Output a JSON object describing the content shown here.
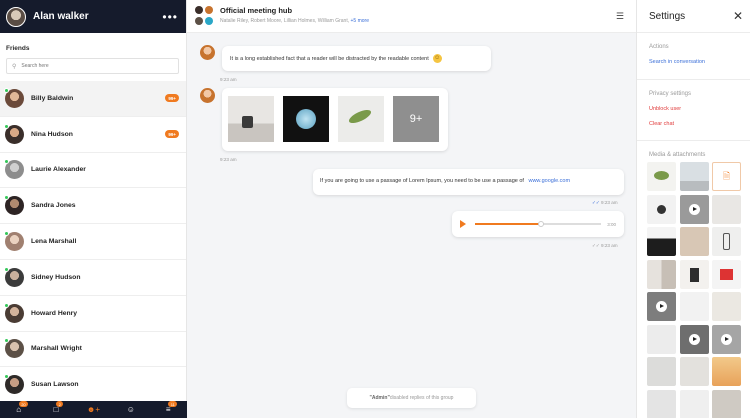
{
  "user": {
    "name": "Alan walker",
    "more_icon": "ellipsis-icon"
  },
  "friends": {
    "label": "Friends",
    "search_placeholder": "Search here",
    "items": [
      {
        "name": "Billy Baldwin",
        "badge": "99+",
        "color": "#6b4a3a"
      },
      {
        "name": "Nina Hudson",
        "badge": "99+",
        "color": "#3a2e2a"
      },
      {
        "name": "Laurie Alexander",
        "badge": "",
        "color": "#8d8d8d"
      },
      {
        "name": "Sandra Jones",
        "badge": "",
        "color": "#2d2424"
      },
      {
        "name": "Lena Marshall",
        "badge": "",
        "color": "#a08070"
      },
      {
        "name": "Sidney Hudson",
        "badge": "",
        "color": "#3b3b3b"
      },
      {
        "name": "Howard Henry",
        "badge": "",
        "color": "#4a3c34"
      },
      {
        "name": "Marshall Wright",
        "badge": "",
        "color": "#5c5046"
      },
      {
        "name": "Susan Lawson",
        "badge": "",
        "color": "#2e2a28"
      }
    ]
  },
  "bottom_nav": [
    {
      "icon": "home-icon",
      "badge": "20"
    },
    {
      "icon": "chat-icon",
      "badge": "2"
    },
    {
      "icon": "add-user-icon",
      "badge": ""
    },
    {
      "icon": "users-icon",
      "badge": ""
    },
    {
      "icon": "layers-icon",
      "badge": "11"
    }
  ],
  "chat": {
    "title": "Official meeting hub",
    "members": "Natalie Riley, Robert Moore, Lillian Holmes, William Grant,",
    "more_members": "+5 more",
    "messages": [
      {
        "text": "It is a long established fact that a reader will be distracted by the readable content",
        "time": "9:23 am"
      },
      {
        "images_more": "9+",
        "time": "9:23 am"
      },
      {
        "text": "If you are going to use a passage of Lorem Ipsum, you need to be use a passage of",
        "link": "www.google.com",
        "time": "9:23 am"
      },
      {
        "audio_duration": "3:00",
        "progress": 0.52,
        "time": "9:23 am"
      }
    ],
    "notice_admin": "\"Admin\"",
    "notice_text": " disabled replies of this group"
  },
  "settings": {
    "title": "Settings",
    "actions_title": "Actions",
    "search_link": "Search in conversation",
    "privacy_title": "Privacy settings",
    "unblock": "Unblock user",
    "clear_chat": "Clear chat",
    "media_title": "Media & attachments"
  },
  "colors": {
    "accent": "#f07a1f",
    "dark": "#151b2c",
    "link": "#3b6fd8",
    "danger": "#e03b3b",
    "online": "#34c759"
  }
}
